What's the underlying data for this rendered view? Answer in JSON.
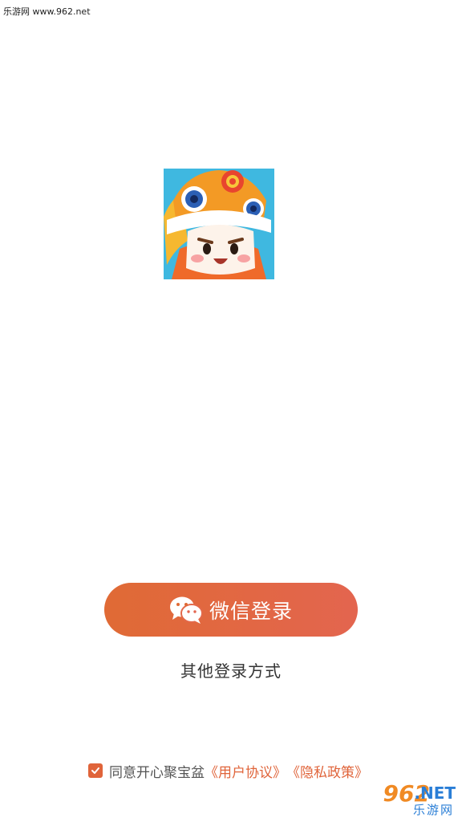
{
  "watermark_top": "乐游网 www.962.net",
  "app_logo": {
    "icon": "lion-dance-mascot-icon"
  },
  "login": {
    "wechat_button_label": "微信登录",
    "wechat_icon": "wechat-icon",
    "other_methods_label": "其他登录方式"
  },
  "agreement": {
    "checked": true,
    "prefix": "同意开心聚宝盆",
    "user_agreement_link": "《用户协议》",
    "privacy_policy_link": "《隐私政策》"
  },
  "watermark_bottom": {
    "number": "962",
    "suffix": ".NET",
    "chinese": "乐游网"
  },
  "colors": {
    "accent": "#e0643a",
    "button_gradient_start": "#e06a35",
    "button_gradient_end": "#e3654f"
  }
}
